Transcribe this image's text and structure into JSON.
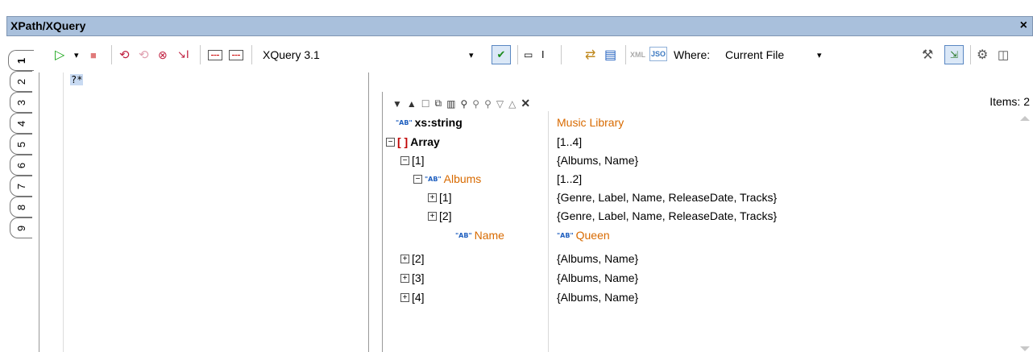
{
  "window": {
    "title": "XPath/XQuery",
    "close": "×"
  },
  "toolbar": {
    "play": "▷",
    "play_dropdown": "▾",
    "stop": "■",
    "language": "XQuery 3.1",
    "language_dropdown": "▾",
    "xml_label": "XML",
    "json_label": "JSO",
    "where_label": "Where:",
    "where_value": "Current File",
    "where_dropdown": "▾"
  },
  "tabs": [
    "1",
    "2",
    "3",
    "4",
    "5",
    "6",
    "7",
    "8",
    "9"
  ],
  "editor": {
    "text": "?*"
  },
  "results": {
    "items_label": "Items: 2",
    "toolbar_icons": [
      "▼",
      "▲",
      "☐",
      "⧉",
      "▥",
      "⚲",
      "⚲",
      "⚲",
      "▽",
      "△",
      "✕"
    ],
    "rows": [
      {
        "left_tag": "\"AB\"",
        "left": "xs:string",
        "right": "Music Library"
      },
      {
        "left_tag": "[ ]",
        "left": "Array",
        "right": "[1..4]"
      },
      {
        "left": "[1]",
        "right": "{Albums, Name}"
      },
      {
        "left_tag": "\"AB\"",
        "left": "Albums",
        "right": "[1..2]"
      },
      {
        "left": "[1]",
        "right": "{Genre, Label, Name, ReleaseDate, Tracks}"
      },
      {
        "left": "[2]",
        "right": "{Genre, Label, Name, ReleaseDate, Tracks}"
      },
      {
        "left_tag": "\"AB\"",
        "left": "Name",
        "right_tag": "\"AB\"",
        "right": "Queen"
      },
      {
        "left": "[2]",
        "right": "{Albums, Name}"
      },
      {
        "left": "[3]",
        "right": "{Albums, Name}"
      },
      {
        "left": "[4]",
        "right": "{Albums, Name}"
      }
    ]
  },
  "colors": {
    "titlebar": "#a9c0dc",
    "accent_orange": "#d86a00",
    "string_tag": "#1f5fbf"
  }
}
